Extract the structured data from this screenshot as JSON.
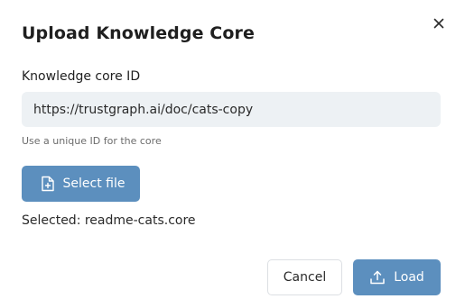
{
  "dialog": {
    "title": "Upload Knowledge Core",
    "close_icon": "close-icon",
    "core_id": {
      "label": "Knowledge core ID",
      "value": "https://trustgraph.ai/doc/cats-copy",
      "helper": "Use a unique ID for the core"
    },
    "select_file": {
      "icon": "file-plus-icon",
      "label": "Select file"
    },
    "selected_text": "Selected: readme-cats.core",
    "actions": {
      "cancel_label": "Cancel",
      "load_icon": "upload-icon",
      "load_label": "Load"
    }
  },
  "colors": {
    "accent": "#5c8fbe",
    "input_background": "#edf1f4",
    "text": "#1f1f1f",
    "muted_text": "#6c6c6c"
  }
}
